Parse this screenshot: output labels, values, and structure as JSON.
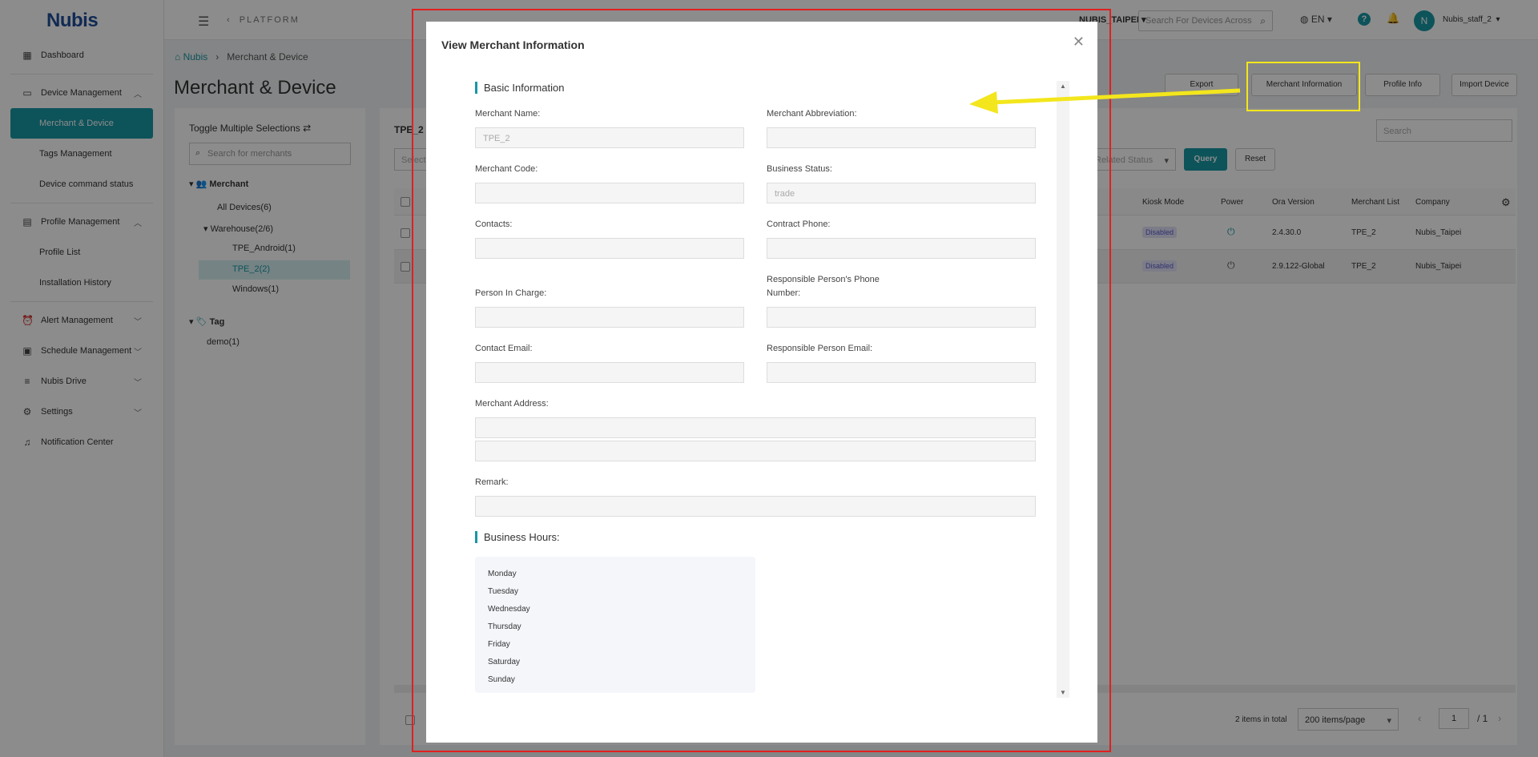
{
  "brand": {
    "logo": "Nubis",
    "accent": "#1897a5"
  },
  "sidebar": {
    "items": [
      {
        "label": "Dashboard",
        "icon": "dashboard-icon"
      },
      {
        "label": "Device Management",
        "icon": "device-icon",
        "expanded": true,
        "children": [
          "Merchant & Device",
          "Tags Management",
          "Device command status"
        ]
      },
      {
        "label": "Profile Management",
        "icon": "profile-icon",
        "expanded": true,
        "children": [
          "Profile List",
          "Installation History"
        ]
      },
      {
        "label": "Alert Management",
        "icon": "alert-icon"
      },
      {
        "label": "Schedule Management",
        "icon": "calendar-icon"
      },
      {
        "label": "Nubis Drive",
        "icon": "drive-icon"
      },
      {
        "label": "Settings",
        "icon": "gear-icon"
      },
      {
        "label": "Notification Center",
        "icon": "bell-icon"
      }
    ],
    "active": "Merchant & Device"
  },
  "topbar": {
    "platform": "PLATFORM",
    "tenant": "NUBIS_TAIPEI",
    "search_placeholder": "Search For Devices Across",
    "language": "EN",
    "avatar_letter": "N",
    "user": "Nubis_staff_2"
  },
  "breadcrumb": {
    "home": "Nubis",
    "current": "Merchant & Device"
  },
  "page_title": "Merchant & Device",
  "tree": {
    "toggle": "Toggle Multiple Selections",
    "search_placeholder": "Search for merchants",
    "merchant_label": "Merchant",
    "all_devices": "All Devices(6)",
    "warehouse": "Warehouse(2/6)",
    "tpe_android": "TPE_Android(1)",
    "tpe_2": "TPE_2(2)",
    "windows": "Windows(1)",
    "tag_label": "Tag",
    "demo": "demo(1)"
  },
  "main": {
    "title": "TPE_2",
    "select_placeholder": "Select",
    "status_placeholder": "Related Status",
    "search_placeholder": "Search",
    "buttons": {
      "export": "Export",
      "merchant_info": "Merchant Information",
      "profile_info": "Profile Info",
      "import": "Import Device",
      "query": "Query",
      "reset": "Reset"
    },
    "columns": {
      "kiosk": "Kiosk Mode",
      "power": "Power",
      "ora": "Ora Version",
      "merchant_list": "Merchant List",
      "company": "Company"
    },
    "rows": [
      {
        "kiosk": "Disabled",
        "ora": "2.4.30.0",
        "merchant": "TPE_2",
        "company": "Nubis_Taipei"
      },
      {
        "kiosk": "Disabled",
        "ora": "2.9.122-Global",
        "merchant": "TPE_2",
        "company": "Nubis_Taipei"
      }
    ],
    "pager": {
      "total": "2 items in total",
      "size": "200 items/page",
      "page": "1",
      "of": "/ 1"
    }
  },
  "modal": {
    "title": "View Merchant Information",
    "basic_section": "Basic Information",
    "fields": {
      "merchant_name": {
        "label": "Merchant Name:",
        "value": "TPE_2"
      },
      "merchant_abbr": {
        "label": "Merchant Abbreviation:",
        "value": ""
      },
      "merchant_code": {
        "label": "Merchant Code:",
        "value": ""
      },
      "business_status": {
        "label": "Business Status:",
        "value": "trade"
      },
      "contacts": {
        "label": "Contacts:",
        "value": ""
      },
      "contract_phone": {
        "label": "Contract Phone:",
        "value": ""
      },
      "person_in_charge": {
        "label": "Person In Charge:",
        "value": ""
      },
      "resp_phone": {
        "label": "Responsible Person's Phone Number:",
        "value": ""
      },
      "contact_email": {
        "label": "Contact Email:",
        "value": ""
      },
      "resp_email": {
        "label": "Responsible Person Email:",
        "value": ""
      },
      "address": {
        "label": "Merchant Address:",
        "value1": "",
        "value2": ""
      },
      "remark": {
        "label": "Remark:",
        "value": ""
      }
    },
    "hours_section": "Business Hours:",
    "days": [
      "Monday",
      "Tuesday",
      "Wednesday",
      "Thursday",
      "Friday",
      "Saturday",
      "Sunday"
    ]
  },
  "annotations": {
    "red_frame_color": "#e02020",
    "yellow_frame_color": "#f3e61c",
    "arrow_color": "#f3e61c"
  }
}
